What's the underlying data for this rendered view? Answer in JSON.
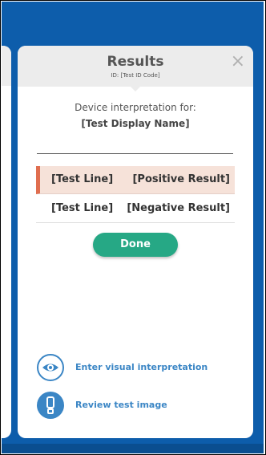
{
  "modal": {
    "title": "Results",
    "subtitle": "ID: [Test ID Code]",
    "close_glyph": "×"
  },
  "interpretation": {
    "label": "Device interpretation for:",
    "test_name": "[Test Display Name]"
  },
  "results": [
    {
      "line": "[Test Line]",
      "result": "[Positive Result]",
      "status": "positive"
    },
    {
      "line": "[Test Line]",
      "result": "[Negative Result]",
      "status": "negative"
    }
  ],
  "buttons": {
    "done": "Done"
  },
  "actions": {
    "visual": {
      "label": "Enter visual interpretation",
      "icon": "eye-icon"
    },
    "image": {
      "label": "Review test image",
      "icon": "exclamation-icon"
    }
  },
  "colors": {
    "background": "#0d5dab",
    "accent": "#3b86c5",
    "done": "#26a885",
    "positive_bg": "#f6e2d9",
    "positive_marker": "#e06e4f"
  }
}
